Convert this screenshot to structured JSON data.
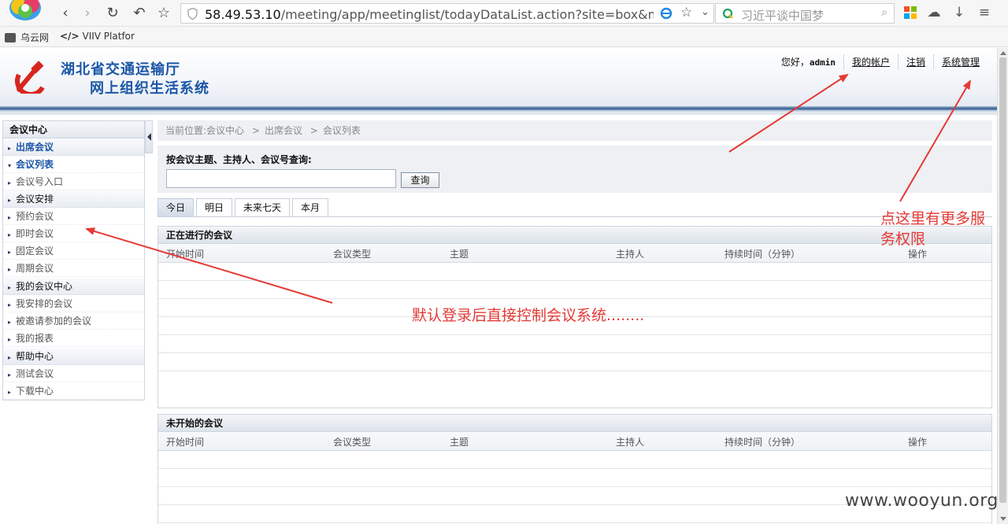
{
  "browser": {
    "url_host": "58.49.53.10",
    "url_path": "/meeting/app/meetinglist/todayDataList.action?site=box&menuna",
    "search_placeholder": "习近平谈中国梦",
    "bookmarks": [
      "乌云网",
      "VIIV Platfor"
    ],
    "bookmark_code_glyph": "</>"
  },
  "header": {
    "title_line1": "湖北省交通运输厅",
    "title_line2": "网上组织生活系统",
    "greeting": "您好，",
    "username": "admin",
    "my_account": "我的帐户",
    "logout": "注销",
    "system_admin": "系统管理"
  },
  "sidebar": {
    "title": "会议中心",
    "items": [
      {
        "label": "出席会议",
        "kind": "group",
        "active": true
      },
      {
        "label": "会议列表",
        "kind": "sub",
        "active": true
      },
      {
        "label": "会议号入口",
        "kind": "sub"
      },
      {
        "label": "会议安排",
        "kind": "group"
      },
      {
        "label": "预约会议",
        "kind": "sub"
      },
      {
        "label": "即时会议",
        "kind": "sub"
      },
      {
        "label": "固定会议",
        "kind": "sub"
      },
      {
        "label": "周期会议",
        "kind": "sub"
      },
      {
        "label": "我的会议中心",
        "kind": "group"
      },
      {
        "label": "我安排的会议",
        "kind": "sub"
      },
      {
        "label": "被邀请参加的会议",
        "kind": "sub"
      },
      {
        "label": "我的报表",
        "kind": "sub"
      },
      {
        "label": "帮助中心",
        "kind": "group"
      },
      {
        "label": "测试会议",
        "kind": "sub"
      },
      {
        "label": "下载中心",
        "kind": "sub"
      }
    ]
  },
  "breadcrumb": {
    "prefix": "当前位置:",
    "path": [
      "会议中心",
      "出席会议",
      "会议列表"
    ],
    "separator": ">"
  },
  "search": {
    "label": "按会议主题、主持人、会议号查询:",
    "value": "",
    "button": "查询"
  },
  "tabs": [
    {
      "label": "今日",
      "active": true
    },
    {
      "label": "明日"
    },
    {
      "label": "未来七天"
    },
    {
      "label": "本月"
    }
  ],
  "columns": [
    "开始时间",
    "会议类型",
    "主题",
    "主持人",
    "持续时间（分钟）",
    "操作"
  ],
  "sections": {
    "ongoing_title": "正在进行的会议",
    "upcoming_title": "未开始的会议"
  },
  "annotations": {
    "note_left": "默认登录后直接控制会议系统........",
    "note_right": "点这里有更多服务权限",
    "color": "#e53935"
  },
  "watermark": "www.wooyun.org"
}
